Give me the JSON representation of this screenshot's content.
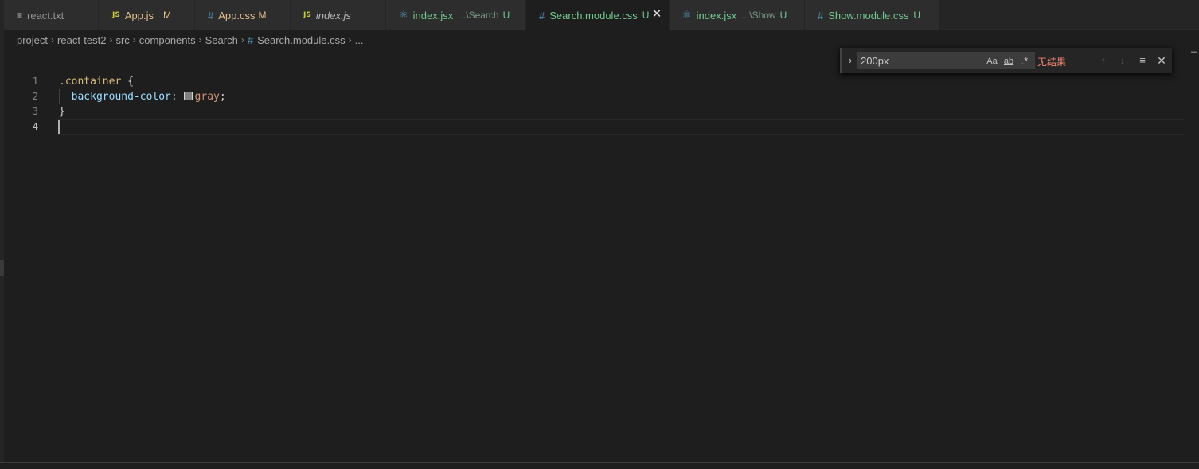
{
  "tabs": [
    {
      "icon": "≡",
      "icon_name": "text-file-icon",
      "label": "react.txt",
      "description": "",
      "status": "",
      "state": "normal"
    },
    {
      "icon": "JS",
      "icon_name": "javascript-icon",
      "label": "App.js",
      "description": "",
      "status": "M",
      "state": "modified"
    },
    {
      "icon": "#",
      "icon_name": "css-icon",
      "label": "App.css",
      "description": "",
      "status": "M",
      "state": "modified"
    },
    {
      "icon": "JS",
      "icon_name": "javascript-icon",
      "label": "index.js",
      "description": "",
      "status": "",
      "state": "preview"
    },
    {
      "icon": "⚛",
      "icon_name": "react-icon",
      "label": "index.jsx",
      "description": "...\\Search",
      "status": "U",
      "state": "untracked"
    },
    {
      "icon": "#",
      "icon_name": "css-icon",
      "label": "Search.module.css",
      "description": "",
      "status": "U",
      "state": "active"
    },
    {
      "icon": "⚛",
      "icon_name": "react-icon",
      "label": "index.jsx",
      "description": "...\\Show",
      "status": "U",
      "state": "untracked"
    },
    {
      "icon": "#",
      "icon_name": "css-icon",
      "label": "Show.module.css",
      "description": "",
      "status": "U",
      "state": "untracked"
    }
  ],
  "close_glyph": "✕",
  "breadcrumb": {
    "items": [
      "project",
      "react-test2",
      "src",
      "components",
      "Search"
    ],
    "file_icon": "#",
    "file": "Search.module.css",
    "more": "...",
    "separator": "›"
  },
  "editor": {
    "line_numbers": [
      "1",
      "2",
      "3",
      "4"
    ],
    "current_line": "4",
    "code": {
      "selector": ".container",
      "open_brace": " {",
      "property": "background-color",
      "colon": ": ",
      "value": "gray",
      "semicolon": ";",
      "close_brace": "}"
    }
  },
  "find": {
    "query": "200px",
    "toggle_glyph": "›",
    "match_case": "Aa",
    "match_word": "ab",
    "regex": ".*",
    "result": "无结果",
    "prev_glyph": "↑",
    "next_glyph": "↓",
    "selection_glyph": "≡",
    "close_glyph": "✕"
  },
  "colors": {
    "background": "#1e1e1e",
    "tab_inactive": "#2d2d2d",
    "modified": "#e2c08d",
    "untracked": "#73c991",
    "css_icon": "#519aba",
    "js_icon": "#cbcb41",
    "no_results": "#f48771",
    "swatch_gray": "#808080"
  }
}
